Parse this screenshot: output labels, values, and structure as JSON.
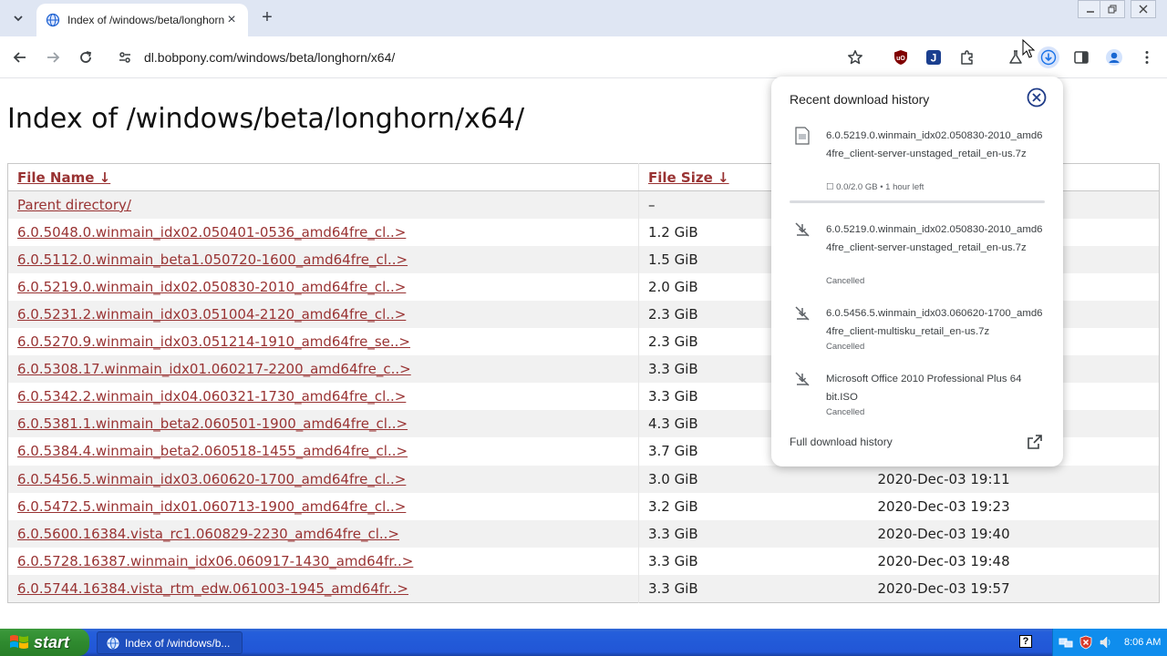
{
  "browser": {
    "tab": {
      "title": "Index of /windows/beta/longhorn",
      "close_glyph": "×"
    },
    "new_tab_glyph": "+",
    "url": "dl.bobpony.com/windows/beta/longhorn/x64/",
    "accent_color": "#1a73e8"
  },
  "page": {
    "heading": "Index of /windows/beta/longhorn/x64/",
    "columns": {
      "name": "File Name  ↓",
      "size": "File Size  ↓"
    },
    "rows": [
      {
        "name": "Parent directory/",
        "size": "–",
        "date": ""
      },
      {
        "name": "6.0.5048.0.winmain_idx02.050401-0536_amd64fre_cl..>",
        "size": "1.2 GiB",
        "date": ""
      },
      {
        "name": "6.0.5112.0.winmain_beta1.050720-1600_amd64fre_cl..>",
        "size": "1.5 GiB",
        "date": ""
      },
      {
        "name": "6.0.5219.0.winmain_idx02.050830-2010_amd64fre_cl..>",
        "size": "2.0 GiB",
        "date": ""
      },
      {
        "name": "6.0.5231.2.winmain_idx03.051004-2120_amd64fre_cl..>",
        "size": "2.3 GiB",
        "date": ""
      },
      {
        "name": "6.0.5270.9.winmain_idx03.051214-1910_amd64fre_se..>",
        "size": "2.3 GiB",
        "date": ""
      },
      {
        "name": "6.0.5308.17.winmain_idx01.060217-2200_amd64fre_c..>",
        "size": "3.3 GiB",
        "date": ""
      },
      {
        "name": "6.0.5342.2.winmain_idx04.060321-1730_amd64fre_cl..>",
        "size": "3.3 GiB",
        "date": ""
      },
      {
        "name": "6.0.5381.1.winmain_beta2.060501-1900_amd64fre_cl..>",
        "size": "4.3 GiB",
        "date": ""
      },
      {
        "name": "6.0.5384.4.winmain_beta2.060518-1455_amd64fre_cl..>",
        "size": "3.7 GiB",
        "date": ""
      },
      {
        "name": "6.0.5456.5.winmain_idx03.060620-1700_amd64fre_cl..>",
        "size": "3.0 GiB",
        "date": "2020-Dec-03 19:11"
      },
      {
        "name": "6.0.5472.5.winmain_idx01.060713-1900_amd64fre_cl..>",
        "size": "3.2 GiB",
        "date": "2020-Dec-03 19:23"
      },
      {
        "name": "6.0.5600.16384.vista_rc1.060829-2230_amd64fre_cl..>",
        "size": "3.3 GiB",
        "date": "2020-Dec-03 19:40"
      },
      {
        "name": "6.0.5728.16387.winmain_idx06.060917-1430_amd64fr..>",
        "size": "3.3 GiB",
        "date": "2020-Dec-03 19:48"
      },
      {
        "name": "6.0.5744.16384.vista_rtm_edw.061003-1945_amd64fr..>",
        "size": "3.3 GiB",
        "date": "2020-Dec-03 19:57"
      }
    ]
  },
  "downloads": {
    "title": "Recent download history",
    "items": [
      {
        "name": "6.0.5219.0.winmain_idx02.050830-2010_amd64fre_client-server-unstaged_retail_en-us.7z",
        "status": "☐ 0.0/2.0 GB • 1 hour left",
        "icon": "file-icon",
        "progress": 0.0
      },
      {
        "name": "6.0.5219.0.winmain_idx02.050830-2010_amd64fre_client-server-unstaged_retail_en-us.7z",
        "status": "Cancelled",
        "icon": "download-off-icon"
      },
      {
        "name": "6.0.5456.5.winmain_idx03.060620-1700_amd64fre_client-multisku_retail_en-us.7z",
        "status": "Cancelled",
        "icon": "download-off-icon"
      },
      {
        "name": "Microsoft Office 2010 Professional Plus 64bit.ISO",
        "status": "Cancelled",
        "icon": "download-off-icon"
      }
    ],
    "footer": "Full download history"
  },
  "taskbar": {
    "start_label": "start",
    "window_button": "Index of /windows/b...",
    "help_glyph": "?",
    "clock": "8:06 AM"
  }
}
